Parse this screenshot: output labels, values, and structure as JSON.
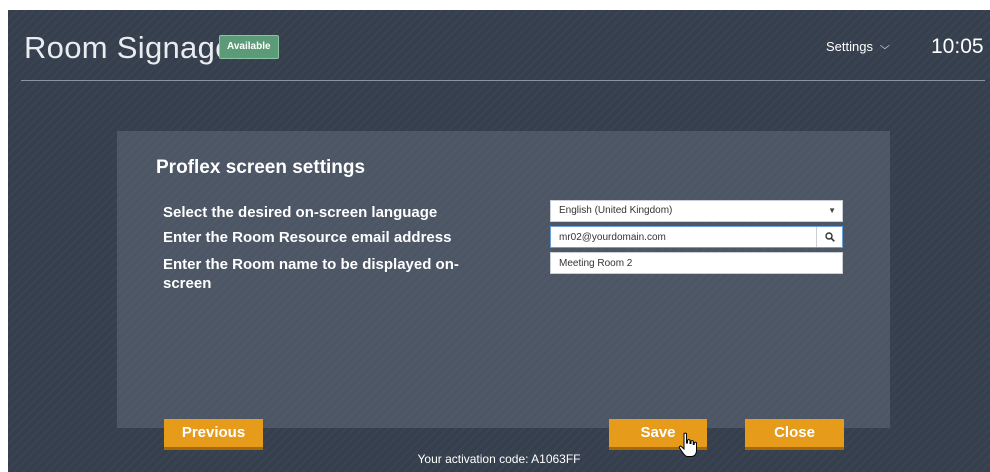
{
  "header": {
    "app_title": "Room Signage",
    "status_badge": "Available",
    "settings_label": "Settings",
    "time": "10:05"
  },
  "panel": {
    "title": "Proflex screen settings",
    "language": {
      "label": "Select the desired on-screen language",
      "selected": "English (United Kingdom)"
    },
    "email": {
      "label": "Enter the Room Resource email address",
      "value": "mr02@yourdomain.com",
      "search_icon": "search-icon"
    },
    "room_name": {
      "label": "Enter the Room name to be displayed on-screen",
      "value": "Meeting Room 2"
    }
  },
  "buttons": {
    "previous": "Previous",
    "save": "Save",
    "close": "Close"
  },
  "footer": {
    "activation_text": "Your activation code: A1063FF"
  },
  "colors": {
    "background": "#363f4d",
    "panel": "#4c5665",
    "accent_button": "#e69b1a",
    "badge": "#5c9b78"
  },
  "icons": {
    "settings_chevron": "chevron-down-icon",
    "select_arrow": "caret-down-icon",
    "cursor": "hand-pointer-icon"
  }
}
